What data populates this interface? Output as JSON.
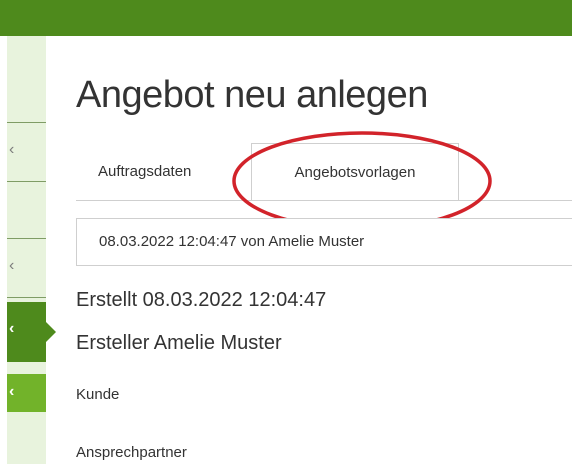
{
  "sidebar": {
    "items": [
      {
        "icon": "chevron-left-icon",
        "glyph": "‹"
      },
      {
        "icon": "chevron-left-icon",
        "glyph": "‹"
      },
      {
        "icon": "chevron-left-icon",
        "glyph": "‹"
      },
      {
        "icon": "chevron-left-icon",
        "glyph": "‹"
      }
    ]
  },
  "page": {
    "title": "Angebot neu anlegen"
  },
  "tabs": [
    {
      "label": "Auftragsdaten",
      "active": false
    },
    {
      "label": "Angebotsvorlagen",
      "active": true
    }
  ],
  "template_select": {
    "value": "08.03.2022 12:04:47 von Amelie Muster"
  },
  "meta": {
    "created": "Erstellt 08.03.2022 12:04:47",
    "creator": "Ersteller Amelie Muster"
  },
  "fields": {
    "kunde_label": "Kunde",
    "ansprechpartner_label": "Ansprechpartner"
  },
  "colors": {
    "brand_green": "#4e8a1c",
    "light_green": "#72b32a",
    "highlight_red": "#d2232a"
  }
}
